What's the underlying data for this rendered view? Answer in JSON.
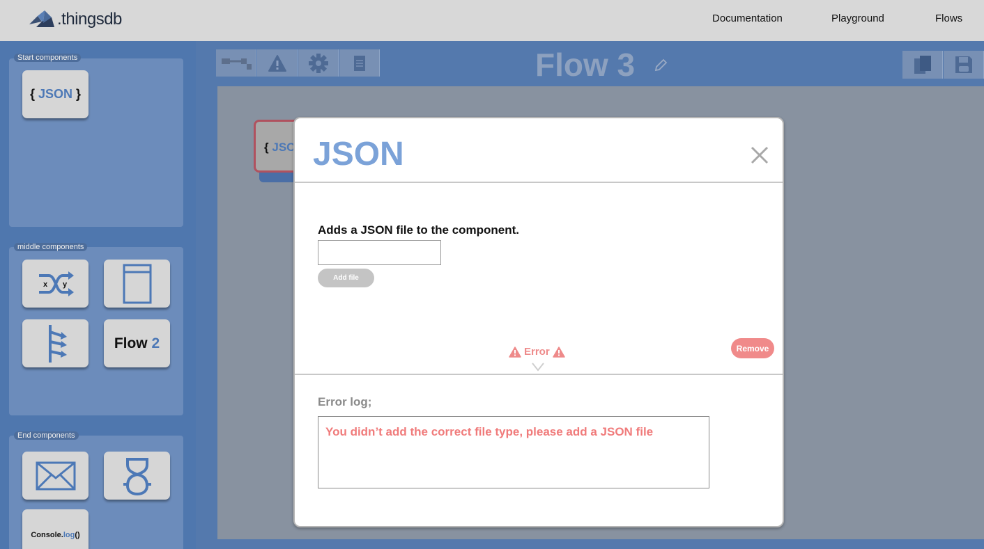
{
  "brand": {
    "logo_text": ".thingsdb"
  },
  "nav": {
    "links": [
      {
        "label": "Documentation"
      },
      {
        "label": "Playground"
      },
      {
        "label": "Flows"
      }
    ]
  },
  "sidebar": {
    "start_label": "Start components",
    "middle_label": "middle components",
    "end_label": "End components",
    "start_tiles": [
      {
        "brace_open": "{",
        "text": "JSON",
        "brace_close": "}"
      }
    ],
    "middle_tiles": [
      {
        "icon": "swap-xy-icon",
        "x_label": "x",
        "y_label": "y"
      },
      {
        "icon": "document-icon"
      },
      {
        "icon": "branch-arrows-icon"
      },
      {
        "text": "Flow",
        "number": "2"
      }
    ],
    "end_tiles": [
      {
        "icon": "mail-icon"
      },
      {
        "icon": "robot-icon"
      },
      {
        "prefix": "Console.",
        "method": "log",
        "suffix": "()"
      }
    ]
  },
  "toolbar": {
    "buttons": [
      {
        "icon": "connector-icon"
      },
      {
        "icon": "warning-icon"
      },
      {
        "icon": "gear-icon"
      },
      {
        "icon": "notes-icon"
      }
    ],
    "right_buttons": [
      {
        "icon": "copy-icon"
      },
      {
        "icon": "save-icon"
      }
    ]
  },
  "workspace": {
    "flow_title": "Flow 3",
    "node": {
      "brace": "{",
      "text": "JSC"
    }
  },
  "modal": {
    "title": "JSON",
    "description": "Adds a JSON file to the component.",
    "file_input_value": "",
    "add_file_label": "Add file",
    "remove_label": "Remove",
    "error_toggle_label": "Error",
    "error_log_label": "Error log;",
    "error_log_text": "You didn’t add the correct file type, please add a JSON file"
  },
  "colors": {
    "accent": "#7ba2d8",
    "error": "#f07b7b",
    "sidebar_bg": "#4f77ae",
    "topbar_bg": "#d8d8d8"
  }
}
